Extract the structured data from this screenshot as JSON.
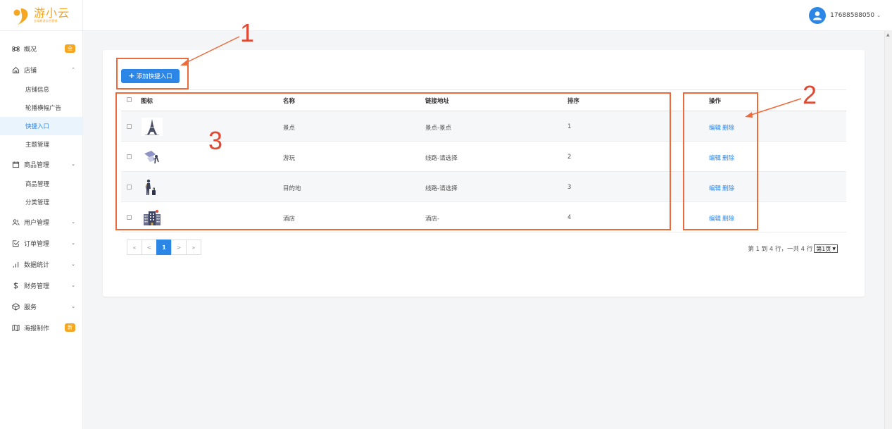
{
  "brand": {
    "title": "游小云",
    "subtitle": "全域旅游云创营销"
  },
  "header": {
    "phone": "17688588050",
    "chevron": "⌄"
  },
  "sidebar": {
    "items": [
      {
        "icon": "command-icon",
        "label": "概况",
        "badge": "全"
      },
      {
        "icon": "home-icon",
        "label": "店铺",
        "chevron": "⌃",
        "children": [
          "店铺信息",
          "轮播横幅广告",
          "快捷入口",
          "主题管理"
        ],
        "active_child": "快捷入口"
      },
      {
        "icon": "calendar-icon",
        "label": "商品管理",
        "chevron": "⌄",
        "children": [
          "商品管理",
          "分类管理"
        ]
      },
      {
        "icon": "users-icon",
        "label": "用户管理",
        "chevron": "⌄"
      },
      {
        "icon": "order-icon",
        "label": "订单管理",
        "chevron": "⌄"
      },
      {
        "icon": "bar-chart-icon",
        "label": "数据统计",
        "chevron": "⌄"
      },
      {
        "icon": "dollar-icon",
        "label": "财务管理",
        "chevron": "⌄"
      },
      {
        "icon": "service-icon",
        "label": "服务",
        "chevron": "⌄"
      },
      {
        "icon": "map-icon",
        "label": "海报制作",
        "badge": "新"
      }
    ]
  },
  "toolbar": {
    "add_label": "添加快捷入口",
    "add_plus": "+"
  },
  "table": {
    "headers": [
      "图标",
      "名称",
      "链接地址",
      "排序",
      "操作"
    ],
    "rows": [
      {
        "icon": "eiffel-tower-icon",
        "name": "景点",
        "link": "景点-景点",
        "order": "1",
        "edit": "编辑",
        "delete": "删除"
      },
      {
        "icon": "travel-play-icon",
        "name": "游玩",
        "link": "线路-请选择",
        "order": "2",
        "edit": "编辑",
        "delete": "删除"
      },
      {
        "icon": "traveler-luggage-icon",
        "name": "目的地",
        "link": "线路-请选择",
        "order": "3",
        "edit": "编辑",
        "delete": "删除"
      },
      {
        "icon": "hotel-building-icon",
        "name": "酒店",
        "link": "酒店-",
        "order": "4",
        "edit": "编辑",
        "delete": "删除"
      }
    ]
  },
  "pagination": {
    "first": "«",
    "prev": "<",
    "current": "1",
    "next": ">",
    "last": "»",
    "info": "第 1 到 4 行，一共 4 行",
    "page_select": "第1页"
  },
  "annotations": {
    "n1": "1",
    "n2": "2",
    "n3": "3"
  },
  "colors": {
    "primary": "#2b86e6",
    "brand": "#f5a623",
    "annotation": "#ec6a3c"
  }
}
